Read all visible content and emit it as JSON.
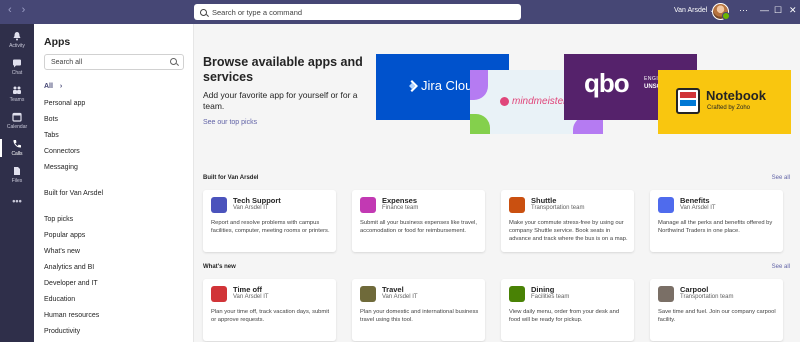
{
  "titlebar": {
    "search_placeholder": "Search or type a command",
    "user_name": "Van Arsdel",
    "back": "‹",
    "forward": "›",
    "more": "···",
    "minimize": "—",
    "maximize": "☐",
    "close": "✕"
  },
  "rail": {
    "items": [
      {
        "label": "Activity",
        "icon": "bell-icon"
      },
      {
        "label": "Chat",
        "icon": "chat-icon"
      },
      {
        "label": "Teams",
        "icon": "teams-icon"
      },
      {
        "label": "Calendar",
        "icon": "calendar-icon"
      },
      {
        "label": "Calls",
        "icon": "phone-icon"
      },
      {
        "label": "Files",
        "icon": "file-icon"
      },
      {
        "label": "•••",
        "icon": "more-icon"
      }
    ]
  },
  "sidenav": {
    "title": "Apps",
    "search_placeholder": "Search all",
    "items": [
      {
        "label": "All",
        "chev": "›"
      },
      {
        "label": "Personal app"
      },
      {
        "label": "Bots"
      },
      {
        "label": "Tabs"
      },
      {
        "label": "Connectors"
      },
      {
        "label": "Messaging"
      },
      {
        "label": "Built for Van Arsdel"
      },
      {
        "label": "Top picks"
      },
      {
        "label": "Popular apps"
      },
      {
        "label": "What's new"
      },
      {
        "label": "Analytics and BI"
      },
      {
        "label": "Developer and IT"
      },
      {
        "label": "Education"
      },
      {
        "label": "Human resources"
      },
      {
        "label": "Productivity"
      }
    ]
  },
  "hero": {
    "title": "Browse available apps and services",
    "subtitle": "Add your favorite app for yourself or for a team.",
    "link": "See our top picks",
    "tiles": {
      "jira": "Jira Cloud",
      "mindmeister": "mindmeister",
      "qbo": "qbo",
      "qbo_small_1": "ENGINEERED",
      "qbo_small_2": "UNSCRAMBLED",
      "notebook_title": "Notebook",
      "notebook_sub": "Crafted by Zoho"
    }
  },
  "sections": [
    {
      "label": "Built for Van Arsdel",
      "see_all": "See all",
      "cards": [
        {
          "name": "Tech Support",
          "publisher": "Van Arsdel IT",
          "desc": "Report and resolve problems with campus facilities, computer, meeting rooms or printers.",
          "color": "#4b53bc",
          "icon": "tech-support-icon"
        },
        {
          "name": "Expenses",
          "publisher": "Finance team",
          "desc": "Submit all your business expenses like travel, accomodation or food for reimbursement.",
          "color": "#c239b3",
          "icon": "expenses-icon"
        },
        {
          "name": "Shuttle",
          "publisher": "Transportation team",
          "desc": "Make your commute stress-free by using our company Shuttle service. Book seats in advance and track where the bus is on a map.",
          "color": "#ca5010",
          "icon": "shuttle-icon"
        },
        {
          "name": "Benefits",
          "publisher": "Van Arsdel IT",
          "desc": "Manage all the perks and benefits offered by Northwind Traders in one place.",
          "color": "#4f6bed",
          "icon": "benefits-icon"
        }
      ]
    },
    {
      "label": "What's new",
      "see_all": "See all",
      "cards": [
        {
          "name": "Time off",
          "publisher": "Van Arsdel IT",
          "desc": "Plan your time off, track vacation days, submit or approve requests.",
          "color": "#d13438",
          "icon": "time-off-icon"
        },
        {
          "name": "Travel",
          "publisher": "Van Arsdel IT",
          "desc": "Plan your domestic and international business travel using this tool.",
          "color": "#6f6a3a",
          "icon": "travel-icon"
        },
        {
          "name": "Dining",
          "publisher": "Facilities team",
          "desc": "View daily menu, order from your desk and food will be ready for pickup.",
          "color": "#498205",
          "icon": "dining-icon"
        },
        {
          "name": "Carpool",
          "publisher": "Transportation team",
          "desc": "Save time and fuel. Join our company carpool facility.",
          "color": "#7a6f66",
          "icon": "carpool-icon"
        }
      ]
    }
  ]
}
